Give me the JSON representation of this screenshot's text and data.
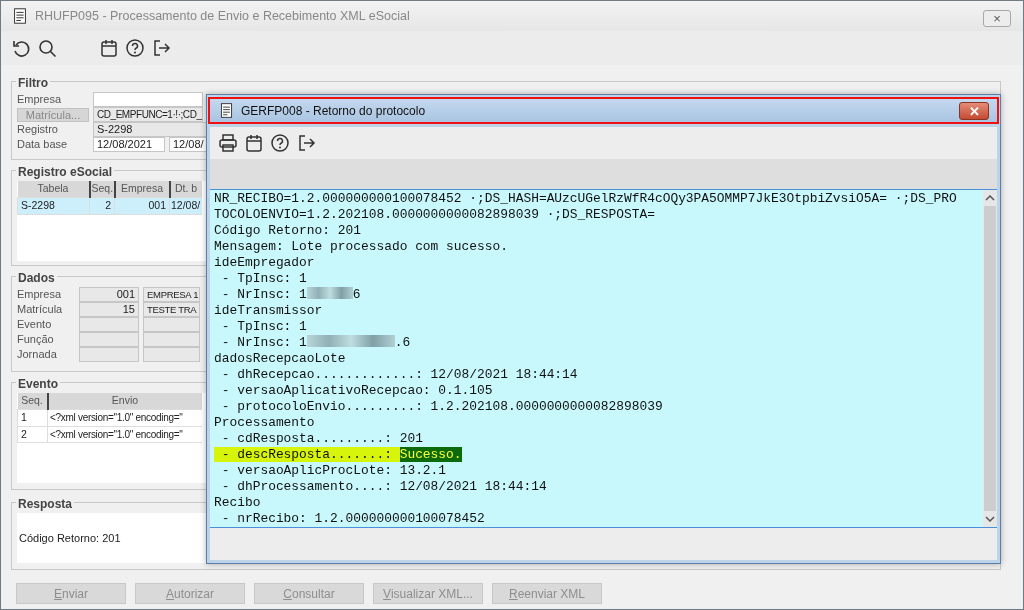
{
  "main_window": {
    "title": "RHUFP095 - Processamento de Envio e Recebimento XML eSocial",
    "close_glyph": "×"
  },
  "filtro": {
    "legend": "Filtro",
    "empresa_label": "Empresa",
    "matricula_button": "Matrícula...",
    "matricula_value": "CD_EMPFUNC=1·!·;CD_",
    "registro_label": "Registro",
    "registro_value": "S-2298",
    "data_base_label": "Data base",
    "data_base_from": "12/08/2021",
    "data_base_to": "12/08/"
  },
  "registro_esocial": {
    "legend": "Registro eSocial",
    "columns": [
      "Tabela",
      "Seq.",
      "Empresa",
      "Dt. b"
    ],
    "rows": [
      {
        "cells": [
          "S-2298",
          "2",
          "001",
          "12/08/"
        ],
        "selected": true
      }
    ]
  },
  "dados": {
    "legend": "Dados",
    "rows": [
      {
        "label": "Empresa",
        "code": "001",
        "name": "EMPRESA 1"
      },
      {
        "label": "Matrícula",
        "code": "15",
        "name": "TESTE TRA"
      },
      {
        "label": "Evento"
      },
      {
        "label": "Função"
      },
      {
        "label": "Jornada"
      }
    ]
  },
  "evento": {
    "legend": "Evento",
    "columns": [
      "Seq.",
      "Envio"
    ],
    "rows": [
      {
        "cells": [
          "1",
          "<?xml version=\"1.0\" encoding=\""
        ]
      },
      {
        "cells": [
          "2",
          "<?xml version=\"1.0\" encoding=\""
        ]
      }
    ]
  },
  "resposta": {
    "legend": "Resposta",
    "text": "Código Retorno: 201"
  },
  "buttons": [
    {
      "label": "Enviar",
      "disabled": true
    },
    {
      "label": "Autorizar",
      "disabled": true
    },
    {
      "label": "Consultar",
      "disabled": true
    },
    {
      "label": "Visualizar XML...",
      "disabled": true
    },
    {
      "label": "Reenviar XML",
      "disabled": true
    }
  ],
  "dialog": {
    "title": "GERFP008 - Retorno do protocolo",
    "close_glyph": "✕",
    "lines": [
      {
        "kind": "plain",
        "text": "NR_RECIBO=1.2.000000000100078452 ·;DS_HASH=AUzcUGelRzWfR4cOQy3PA5OMMP7JkE3OtpbiZvsiO5A= ·;DS_PRO"
      },
      {
        "kind": "plain",
        "text": "TOCOLOENVIO=1.2.202108.0000000000082898039 ·;DS_RESPOSTA="
      },
      {
        "kind": "plain",
        "text": "Código Retorno: 201"
      },
      {
        "kind": "plain",
        "text": "Mensagem: Lote processado com sucesso."
      },
      {
        "kind": "plain",
        "text": "ideEmpregador"
      },
      {
        "kind": "plain",
        "text": " - TpInsc: 1"
      },
      {
        "kind": "redacted",
        "text": " - NrInsc: 1",
        "after": "6"
      },
      {
        "kind": "plain",
        "text": "ideTransmissor"
      },
      {
        "kind": "plain",
        "text": " - TpInsc: 1"
      },
      {
        "kind": "redacted",
        "text": " - NrInsc: 1",
        "after": ".6"
      },
      {
        "kind": "plain",
        "text": "dadosRecepcaoLote"
      },
      {
        "kind": "plain",
        "text": " - dhRecepcao.............: 12/08/2021 18:44:14"
      },
      {
        "kind": "plain",
        "text": " - versaoAplicativoRecepcao: 0.1.105"
      },
      {
        "kind": "plain",
        "text": " - protocoloEnvio.........: 1.2.202108.0000000000082898039"
      },
      {
        "kind": "plain",
        "text": "Processamento"
      },
      {
        "kind": "plain",
        "text": " - cdResposta.........: 201"
      },
      {
        "kind": "highlight",
        "text": " - descResposta.......: ",
        "value": "Sucesso."
      },
      {
        "kind": "plain",
        "text": " - versaoAplicProcLote: 13.2.1"
      },
      {
        "kind": "plain",
        "text": " - dhProcessamento....: 12/08/2021 18:44:14"
      },
      {
        "kind": "plain",
        "text": "Recibo"
      },
      {
        "kind": "plain",
        "text": " - nrRecibo: 1.2.000000000100078452"
      }
    ]
  }
}
